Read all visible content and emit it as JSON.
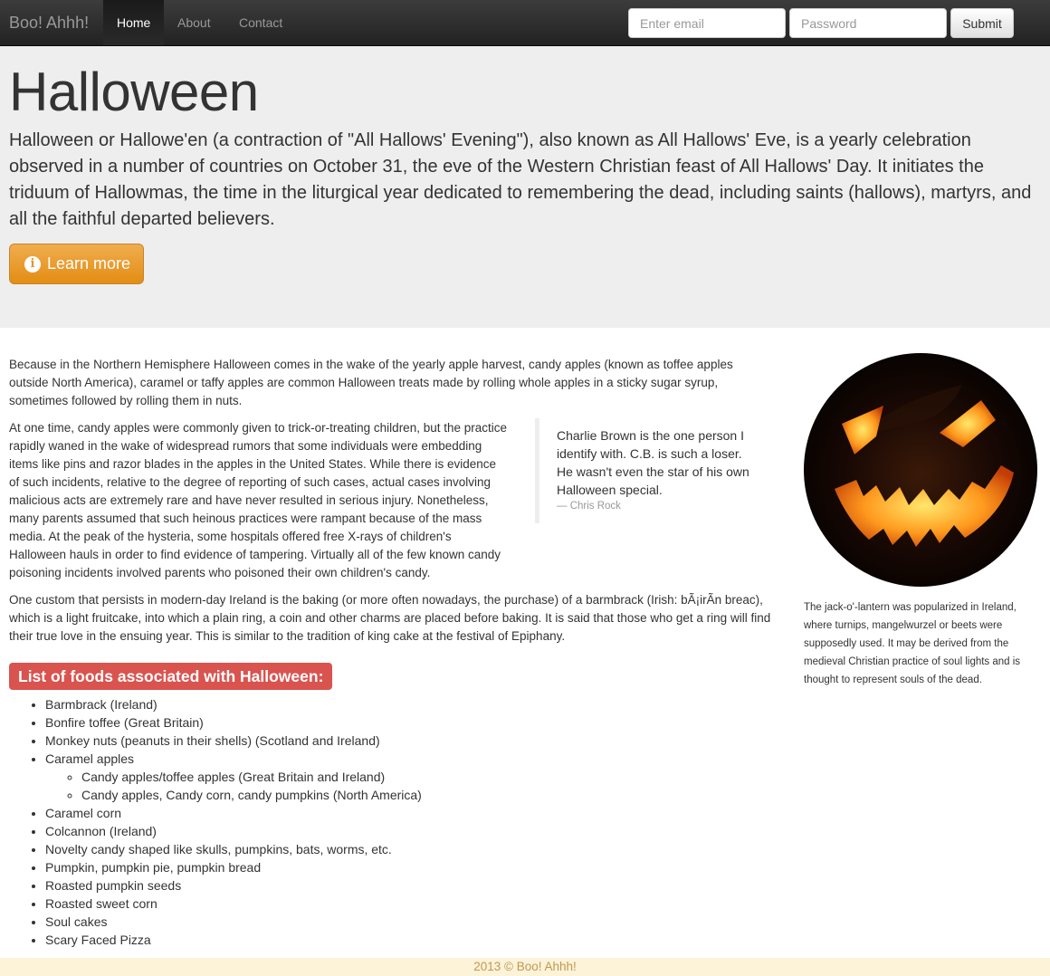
{
  "navbar": {
    "brand": "Boo! Ahhh!",
    "links": [
      "Home",
      "About",
      "Contact"
    ],
    "email_placeholder": "Enter email",
    "password_placeholder": "Password",
    "submit_label": "Submit",
    "colors": {
      "background": "#222222",
      "link": "#999999",
      "active_link": "#ffffff"
    }
  },
  "jumbotron": {
    "title": "Halloween",
    "text": "Halloween or Hallowe'en (a contraction of \"All Hallows' Evening\"), also known as All Hallows' Eve, is a yearly celebration observed in a number of countries on October 31, the eve of the Western Christian feast of All Hallows' Day. It initiates the triduum of Hallowmas, the time in the liturgical year dedicated to remembering the dead, including saints (hallows), martyrs, and all the faithful departed believers.",
    "button_label": "Learn more",
    "button_icon": "info-circle-icon",
    "colors": {
      "background": "#eeeeee",
      "button": "#f0ad4e"
    }
  },
  "content": {
    "paragraphs": [
      "Because in the Northern Hemisphere Halloween comes in the wake of the yearly apple harvest, candy apples (known as toffee apples outside North America), caramel or taffy apples are common Halloween treats made by rolling whole apples in a sticky sugar syrup, sometimes followed by rolling them in nuts.",
      "At one time, candy apples were commonly given to trick-or-treating children, but the practice rapidly waned in the wake of widespread rumors that some individuals were embedding items like pins and razor blades in the apples in the United States. While there is evidence of such incidents, relative to the degree of reporting of such cases, actual cases involving malicious acts are extremely rare and have never resulted in serious injury. Nonetheless, many parents assumed that such heinous practices were rampant because of the mass media. At the peak of the hysteria, some hospitals offered free X-rays of children's Halloween hauls in order to find evidence of tampering. Virtually all of the few known candy poisoning incidents involved parents who poisoned their own children's candy.",
      "One custom that persists in modern-day Ireland is the baking (or more often nowadays, the purchase) of a barmbrack (Irish: bÃ¡irÃn breac), which is a light fruitcake, into which a plain ring, a coin and other charms are placed before baking. It is said that those who get a ring will find their true love in the ensuing year. This is similar to the tradition of king cake at the festival of Epiphany."
    ],
    "quote": {
      "text": "Charlie Brown is the one person I identify with. C.B. is such a loser. He wasn't even the star of his own Halloween special.",
      "cite": "— Chris Rock"
    },
    "image": {
      "name": "jack-o-lantern",
      "caption": "The jack-o'-lantern was popularized in Ireland, where turnips, mangelwurzel or beets were supposedly used. It may be derived from the medieval Christian practice of soul lights and is thought to represent souls of the dead."
    },
    "foods": {
      "label": "List of foods associated with Halloween:",
      "label_color": "#d9534f",
      "items": [
        "Barmbrack (Ireland)",
        "Bonfire toffee (Great Britain)",
        "Monkey nuts (peanuts in their shells) (Scotland and Ireland)",
        "Caramel apples",
        "Caramel corn",
        "Colcannon (Ireland)",
        "Novelty candy shaped like skulls, pumpkins, bats, worms, etc.",
        "Pumpkin, pumpkin pie, pumpkin bread",
        "Roasted pumpkin seeds",
        "Roasted sweet corn",
        "Soul cakes",
        "Scary Faced Pizza"
      ],
      "caramel_apples_subitems": [
        "Candy apples/toffee apples (Great Britain and Ireland)",
        "Candy apples, Candy corn, candy pumpkins (North America)"
      ]
    }
  },
  "footer": {
    "text": "2013 © Boo! Ahhh!",
    "colors": {
      "background": "#fcf3d8",
      "text": "#c09853"
    }
  }
}
